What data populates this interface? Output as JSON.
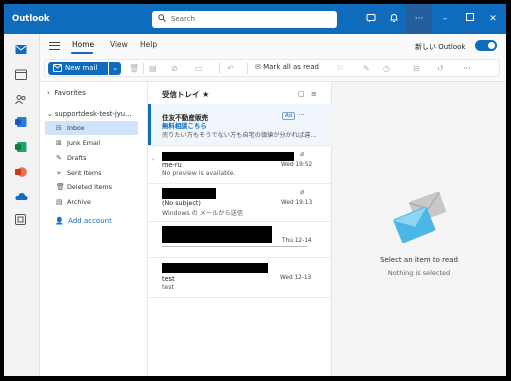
{
  "app": {
    "title": "Outlook"
  },
  "search": {
    "placeholder": "Search"
  },
  "titlebar_icons": [
    "feedback-icon",
    "bell-icon",
    "more-icon",
    "minimize-icon",
    "maximize-icon",
    "close-icon"
  ],
  "ribbon": {
    "tabs": [
      {
        "label": "Home"
      },
      {
        "label": "View"
      },
      {
        "label": "Help"
      }
    ],
    "new_outlook_label": "新しい Outlook",
    "new_mail_label": "New mail",
    "mark_all_read_label": "Mark all as read"
  },
  "folders": {
    "favorites_label": "Favorites",
    "account_label": "supportdesk-test-jyu...",
    "items": [
      {
        "label": "Inbox",
        "icon": "inbox-icon"
      },
      {
        "label": "Junk Email",
        "icon": "junk-icon"
      },
      {
        "label": "Drafts",
        "icon": "drafts-icon"
      },
      {
        "label": "Sent Items",
        "icon": "sent-icon"
      },
      {
        "label": "Deleted Items",
        "icon": "trash-icon"
      },
      {
        "label": "Archive",
        "icon": "archive-icon"
      }
    ],
    "add_account_label": "Add account"
  },
  "message_list": {
    "heading": "受信トレイ",
    "messages": [
      {
        "sender": "住友不動産販売",
        "subject": "無料相談こちら",
        "preview": "売りたい方もそうでない方も自宅の価値が分かれば違...",
        "tag": "Ad"
      },
      {
        "sender": "me-ru",
        "preview": "No preview is available.",
        "date": "Wed 19:52"
      },
      {
        "subject": "(No subject)",
        "preview": "Windows の メールから送信",
        "date": "Wed 19:13"
      },
      {
        "date": "Thu 12-14"
      },
      {
        "sender": "test",
        "preview": "test",
        "date": "Wed 12-13"
      }
    ]
  },
  "reading_pane": {
    "title": "Select an item to read",
    "subtitle": "Nothing is selected"
  },
  "colors": {
    "accent": "#0f6cbd",
    "selected_folder": "#cfe4fa"
  }
}
